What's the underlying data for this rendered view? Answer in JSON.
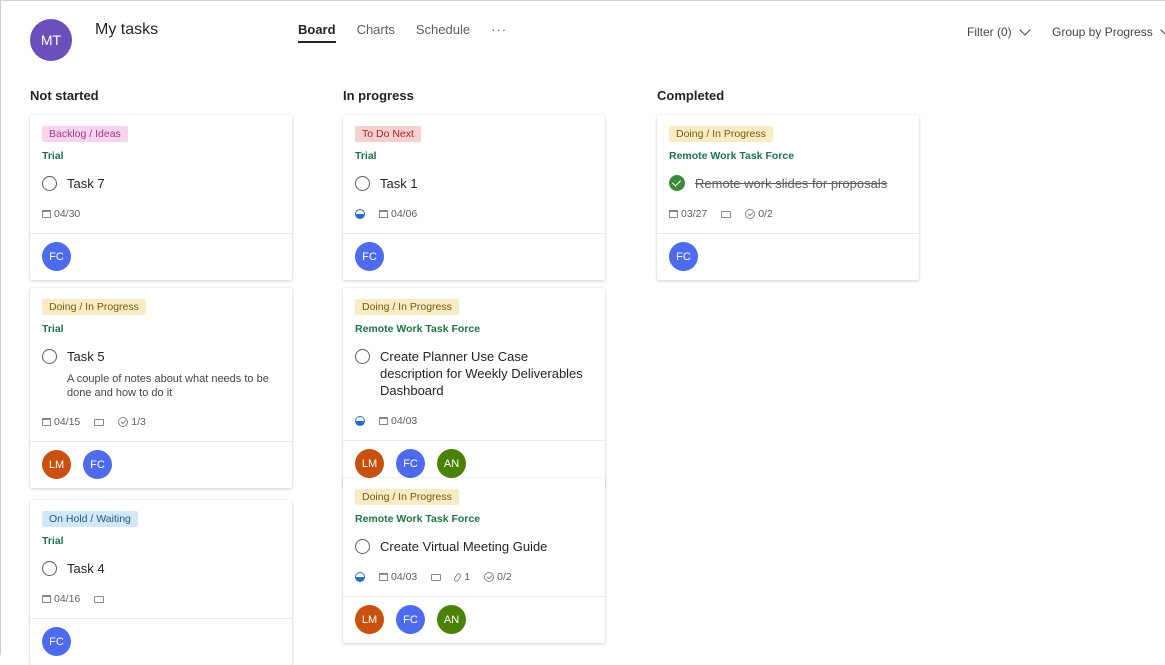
{
  "header": {
    "avatar_initials": "MT",
    "title": "My tasks",
    "tabs": [
      {
        "label": "Board",
        "active": true
      },
      {
        "label": "Charts",
        "active": false
      },
      {
        "label": "Schedule",
        "active": false
      }
    ],
    "more_label": "···",
    "filter_label": "Filter (0)",
    "group_label": "Group by Progress"
  },
  "columns": [
    {
      "title": "Not started",
      "cards": [
        {
          "label": "Backlog / Ideas",
          "label_color": "pink",
          "bucket": "Trial",
          "title": "Task 7",
          "completed": false,
          "due": "04/30",
          "assignees": [
            "FC"
          ]
        },
        {
          "label": "Doing / In Progress",
          "label_color": "yellow",
          "bucket": "Trial",
          "title": "Task 5",
          "completed": false,
          "notes": "A couple of notes about what needs to be done and how to do it",
          "due": "04/15",
          "has_comment": true,
          "checklist": "1/3",
          "assignees": [
            "LM",
            "FC"
          ]
        },
        {
          "label": "On Hold / Waiting",
          "label_color": "blue",
          "bucket": "Trial",
          "title": "Task 4",
          "completed": false,
          "due": "04/16",
          "has_comment": true,
          "assignees": [
            "FC"
          ]
        }
      ]
    },
    {
      "title": "In progress",
      "cards": [
        {
          "label": "To Do Next",
          "label_color": "red",
          "bucket": "Trial",
          "title": "Task 1",
          "completed": false,
          "in_progress": true,
          "due": "04/06",
          "assignees": [
            "FC"
          ]
        },
        {
          "label": "Doing / In Progress",
          "label_color": "yellow",
          "bucket": "Remote Work Task Force",
          "title": "Create Planner Use Case description for Weekly Deliverables Dashboard",
          "completed": false,
          "in_progress": true,
          "due": "04/03",
          "assignees": [
            "LM",
            "FC",
            "AN"
          ]
        },
        {
          "label": "Doing / In Progress",
          "label_color": "yellow",
          "bucket": "Remote Work Task Force",
          "title": "Create Virtual Meeting Guide",
          "completed": false,
          "in_progress": true,
          "due": "04/03",
          "has_comment": true,
          "attachments": "1",
          "checklist": "0/2",
          "assignees": [
            "LM",
            "FC",
            "AN"
          ]
        }
      ]
    },
    {
      "title": "Completed",
      "cards": [
        {
          "label": "Doing / In Progress",
          "label_color": "yellow",
          "bucket": "Remote Work Task Force",
          "title": "Remote work slides for proposals",
          "completed": true,
          "due": "03/27",
          "has_comment": true,
          "checklist": "0/2",
          "assignees": [
            "FC"
          ]
        }
      ]
    }
  ],
  "colors": {
    "label_pink_bg": "#f6d3ee",
    "label_pink_fg": "#9b3b87",
    "label_yellow_bg": "#f7ecc4",
    "label_yellow_fg": "#7a5a13",
    "label_blue_bg": "#d2e7f7",
    "label_blue_fg": "#215a8a",
    "label_red_bg": "#f6d0d0",
    "label_red_fg": "#a4262c",
    "avatar_FC": "#4f6bed",
    "avatar_LM": "#ca5010",
    "avatar_AN": "#498205",
    "avatar_MT": "#6b4fbb",
    "bucket": "#217346"
  }
}
